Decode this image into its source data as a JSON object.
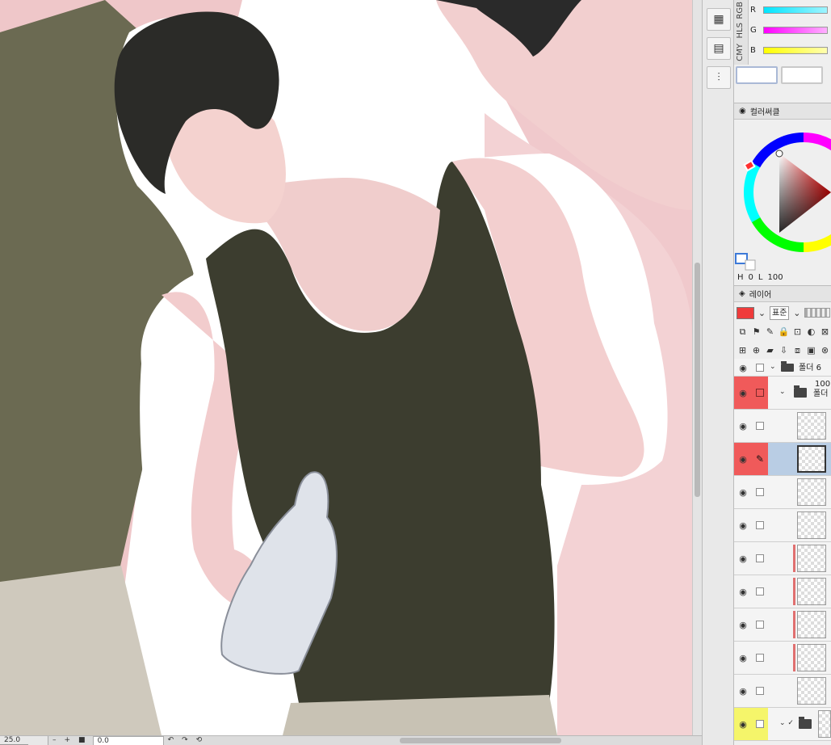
{
  "status_bar": {
    "zoom_value": "25.0",
    "zoom_minus": "–",
    "zoom_plus": "+",
    "angle_value": "0.0",
    "icons": [
      "zoom-minus-icon",
      "zoom-plus-icon",
      "fit-icon",
      "rotate-left-icon",
      "rotate-right-icon",
      "reset-rotation-icon"
    ]
  },
  "color_slider": {
    "tabs": [
      "RGB",
      "HLS",
      "CMY"
    ],
    "channels": [
      {
        "label": "R",
        "color": "#00e5ff"
      },
      {
        "label": "G",
        "color": "#ff00ff"
      },
      {
        "label": "B",
        "color": "#ffff00"
      }
    ]
  },
  "color_wheel": {
    "tab_label": "컬러써클",
    "h_label": "H",
    "h_value": "0",
    "l_label": "L",
    "l_value": "100"
  },
  "layers": {
    "tab_label": "레이어",
    "blend_mode": "표준",
    "main_color": "#ef3b3b",
    "rows": [
      {
        "kind": "folder",
        "name_top": "",
        "name": "폴더 6",
        "mark": "none",
        "indent": 0
      },
      {
        "kind": "folder",
        "name_top": "100",
        "name": "폴더",
        "mark": "red",
        "indent": 1
      },
      {
        "kind": "layer",
        "mark": "none"
      },
      {
        "kind": "layer",
        "mark": "red",
        "selected": true
      },
      {
        "kind": "layer",
        "mark": "none"
      },
      {
        "kind": "layer",
        "mark": "none"
      },
      {
        "kind": "layer",
        "mark": "none",
        "clip": true
      },
      {
        "kind": "layer",
        "mark": "none",
        "clip": true
      },
      {
        "kind": "layer",
        "mark": "none",
        "clip": true
      },
      {
        "kind": "layer",
        "mark": "none",
        "clip": true
      },
      {
        "kind": "layer",
        "mark": "none"
      },
      {
        "kind": "folder",
        "name_top": "",
        "name": "",
        "mark": "yellow",
        "indent": 1
      }
    ]
  }
}
